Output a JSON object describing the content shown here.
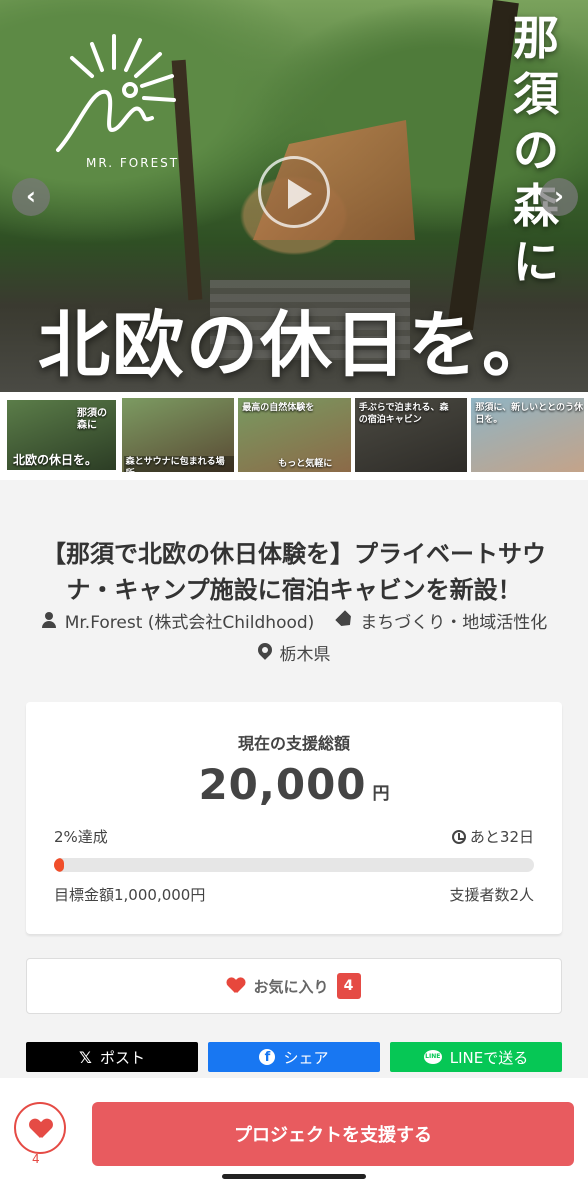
{
  "hero": {
    "logo_text": "MR. FOREST",
    "vertical_text": [
      "那",
      "須",
      "の",
      "森",
      "に"
    ],
    "headline": "北欧の休日を。",
    "prev_icon": "chevron-left-icon",
    "next_icon": "chevron-right-icon",
    "play_icon": "play-icon"
  },
  "thumbnails": [
    {
      "caption_top": "那須の森に",
      "caption_bottom": "北欧の休日を。"
    },
    {
      "caption_top": "",
      "caption_bottom": "森とサウナに包まれる場所。"
    },
    {
      "caption_top": "最高の自然体験を",
      "caption_bottom": "もっと気軽に"
    },
    {
      "caption_top": "手ぶらで泊まれる、森の宿泊キャビン",
      "caption_bottom": ""
    },
    {
      "caption_top": "那須に、新しいととのう休日を。",
      "caption_bottom": ""
    }
  ],
  "project": {
    "title": "【那須で北欧の休日体験を】プライベートサウナ・キャンプ施設に宿泊キャビンを新設！",
    "owner": "Mr.Forest (株式会社Childhood)",
    "category": "まちづくり・地域活性化",
    "location": "栃木県"
  },
  "funding": {
    "label": "現在の支援総額",
    "amount": "20,000",
    "unit": "円",
    "achievement": "2%達成",
    "days_left": "あと32日",
    "progress_percent": 2,
    "goal": "目標金額1,000,000円",
    "backers": "支援者数2人"
  },
  "favorite": {
    "label": "お気に入り",
    "count": "4"
  },
  "share": {
    "x_label": "ポスト",
    "facebook_label": "シェア",
    "line_label": "LINEで送る"
  },
  "bottom_bar": {
    "heart_count": "4",
    "support_label": "プロジェクトを支援する"
  },
  "colors": {
    "accent": "#e85b5f",
    "progress": "#f04e2a",
    "facebook": "#1877f2",
    "line": "#06c755"
  }
}
